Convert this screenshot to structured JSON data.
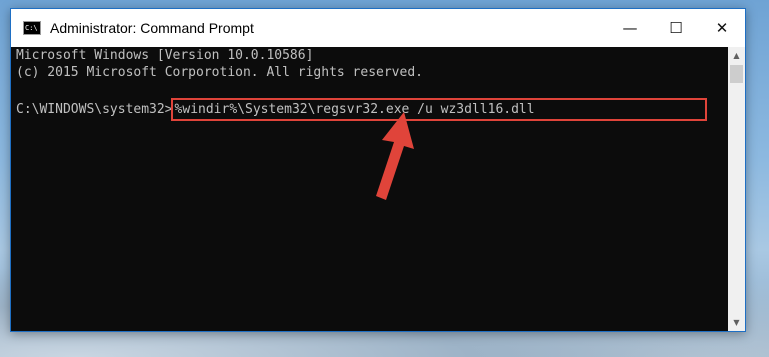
{
  "window": {
    "title": "Administrator: Command Prompt",
    "icon": "cmd-icon",
    "controls": {
      "minimize": "—",
      "maximize": "☐",
      "close": "✕"
    }
  },
  "console": {
    "lines": [
      "Microsoft Windows [Version 10.0.10586]",
      "(c) 2015 Microsoft Corporotion. All rights reserved."
    ],
    "prompt": "C:\\WINDOWS\\system32>",
    "command": "%windir%\\System32\\regsvr32.exe /u wz3dll16.dll"
  },
  "scrollbar": {
    "up_icon": "▲",
    "down_icon": "▼"
  },
  "annotation": {
    "highlight_color": "#e0443a",
    "arrow_icon": "red-arrow-icon"
  }
}
